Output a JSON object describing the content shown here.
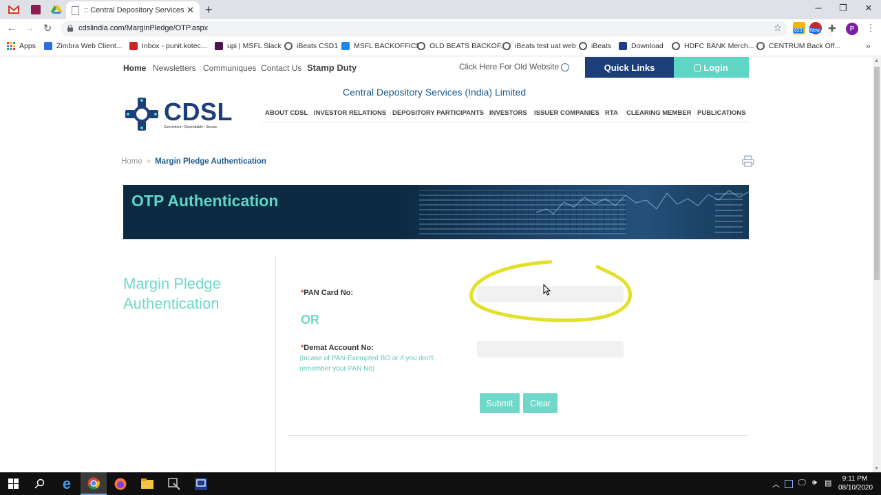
{
  "browser": {
    "tab_title": ":: Central Depository Services (India) Limited",
    "url": "cdslindia.com/MarginPledge/OTP.aspx",
    "profile_initial": "P",
    "extension_badge_1": "623",
    "extension_badge_2": "New",
    "bookmarks": [
      {
        "label": "Apps",
        "color": "#e53935"
      },
      {
        "label": "Zimbra Web Client...",
        "color": "#2a6ee0"
      },
      {
        "label": "Inbox - punit.kotec...",
        "color": "#c62828"
      },
      {
        "label": "upi | MSFL Slack",
        "color": "#4a154b"
      },
      {
        "label": "iBeats CSD1",
        "color": "globe"
      },
      {
        "label": "MSFL BACKOFFICE",
        "color": "#1e88e5"
      },
      {
        "label": "OLD BEATS BACKOF...",
        "color": "globe"
      },
      {
        "label": "iBeats test uat web",
        "color": "globe"
      },
      {
        "label": "iBeats",
        "color": "globe"
      },
      {
        "label": "Download",
        "color": "#1e3a8a"
      },
      {
        "label": "HDFC BANK Merch...",
        "color": "globe"
      },
      {
        "label": "CENTRUM Back Off...",
        "color": "globe"
      }
    ]
  },
  "site": {
    "top_nav": {
      "home": "Home",
      "newsletters": "Newsletters",
      "communiques": "Communiques",
      "contact": "Contact Us",
      "stamp_duty": "Stamp Duty"
    },
    "old_website": "Click Here For Old Website",
    "quick_links": "Quick Links",
    "login": "Login",
    "company_name": "Central Depository Services (India) Limited",
    "logo_text": "CDSL",
    "logo_tagline": "Convenient  •  Dependable  •  Secure",
    "main_nav": [
      "ABOUT CDSL",
      "INVESTOR RELATIONS",
      "DEPOSITORY PARTICIPANTS",
      "INVESTORS",
      "ISSUER COMPANIES",
      "RTA",
      "CLEARING MEMBER",
      "PUBLICATIONS"
    ],
    "breadcrumb": {
      "home": "Home",
      "sep": "»",
      "current": "Margin Pledge Authentication"
    },
    "banner_title": "OTP Authentication",
    "side_title": "Margin Pledge Authentication",
    "form": {
      "required_mark": "*",
      "pan_label": "PAN Card No:",
      "pan_value": "",
      "or": "OR",
      "demat_label": "Demat Account No:",
      "demat_hint": "(Incase of PAN-Exempted BO or if you don't remember your PAN No)",
      "demat_value": "",
      "submit": "Submit",
      "clear": "Clear"
    },
    "colors": {
      "primary": "#1c3f7a",
      "accent": "#6fd8c8",
      "annotation": "#e3e02a"
    }
  },
  "taskbar": {
    "time": "9:11 PM",
    "date": "08/10/2020"
  }
}
